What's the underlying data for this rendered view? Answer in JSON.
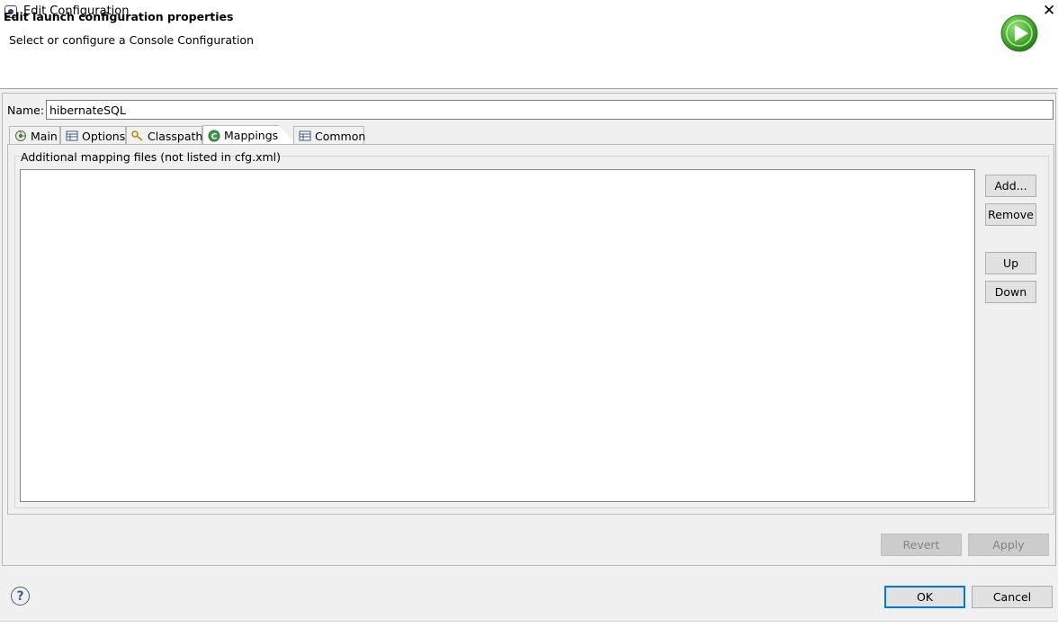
{
  "window": {
    "title": "Edit Configuration",
    "close_glyph": "✕"
  },
  "header": {
    "title": "Edit launch configuration properties",
    "description": "Select or configure a Console Configuration",
    "icon": "run-icon"
  },
  "name_field": {
    "label": "Name:",
    "value": "hibernateSQL"
  },
  "tabs": [
    {
      "label": "Main",
      "icon": "main-tab-icon",
      "selected": false
    },
    {
      "label": "Options",
      "icon": "options-table-icon",
      "selected": false
    },
    {
      "label": "Classpath",
      "icon": "classpath-icon",
      "selected": false
    },
    {
      "label": "Mappings",
      "icon": "hibernate-mappings-icon",
      "selected": true
    },
    {
      "label": "Common",
      "icon": "common-table-icon",
      "selected": false
    }
  ],
  "mappings": {
    "group_label": "Additional mapping files (not listed in cfg.xml)",
    "files": [],
    "buttons": {
      "add": "Add...",
      "remove": "Remove",
      "up": "Up",
      "down": "Down"
    }
  },
  "actions": {
    "revert": "Revert",
    "apply": "Apply"
  },
  "dialog_buttons": {
    "ok": "OK",
    "cancel": "Cancel"
  },
  "help": {
    "glyph": "?"
  },
  "colors": {
    "accent": "#0078d7",
    "run_icon_green": "#4caf33",
    "hibernate_green": "#3c9a4a"
  }
}
